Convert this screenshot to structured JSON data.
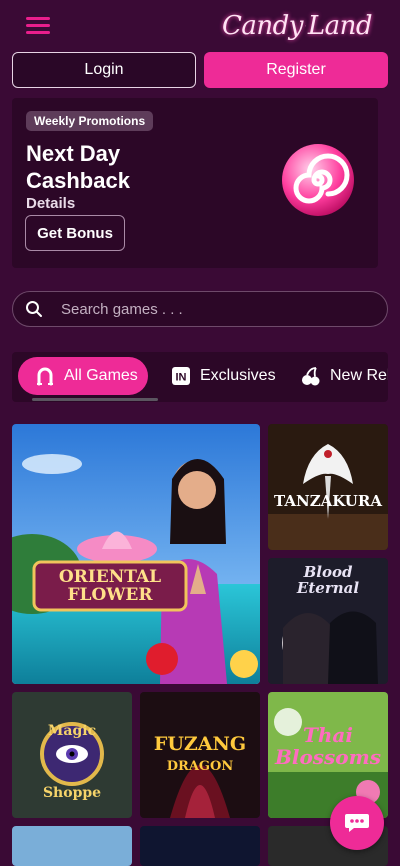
{
  "header": {
    "menu_icon": "hamburger-icon",
    "logo_text_left": "Candy",
    "logo_text_right": "Land"
  },
  "auth": {
    "login_label": "Login",
    "register_label": "Register"
  },
  "promo": {
    "badge": "Weekly Promotions",
    "title": "Next Day Cashback",
    "details": "Details",
    "button": "Get Bonus"
  },
  "search": {
    "placeholder": "Search games . . ."
  },
  "tabs": [
    {
      "label": "All Games",
      "icon": "horseshoe-icon",
      "active": true
    },
    {
      "label": "Exclusives",
      "icon": "exclusive-badge-icon",
      "active": false
    },
    {
      "label": "New Rele",
      "icon": "cherries-icon",
      "active": false
    }
  ],
  "games": [
    {
      "title_line1": "ORIENTAL",
      "title_line2": "FLOWER"
    },
    {
      "title": "TANZAKURA"
    },
    {
      "title_line1": "Blood",
      "title_line2": "Eternal"
    },
    {
      "title_line1": "Magic",
      "title_line2": "Shoppe"
    },
    {
      "title_line1": "FUZANG",
      "title_line2": "DRAGON"
    },
    {
      "title_line1": "Thai",
      "title_line2": "Blossoms"
    }
  ],
  "colors": {
    "background": "#3a0a35",
    "accent": "#ee2b97",
    "panel": "#2c0727"
  },
  "chat_icon": "chat-bubble-icon"
}
